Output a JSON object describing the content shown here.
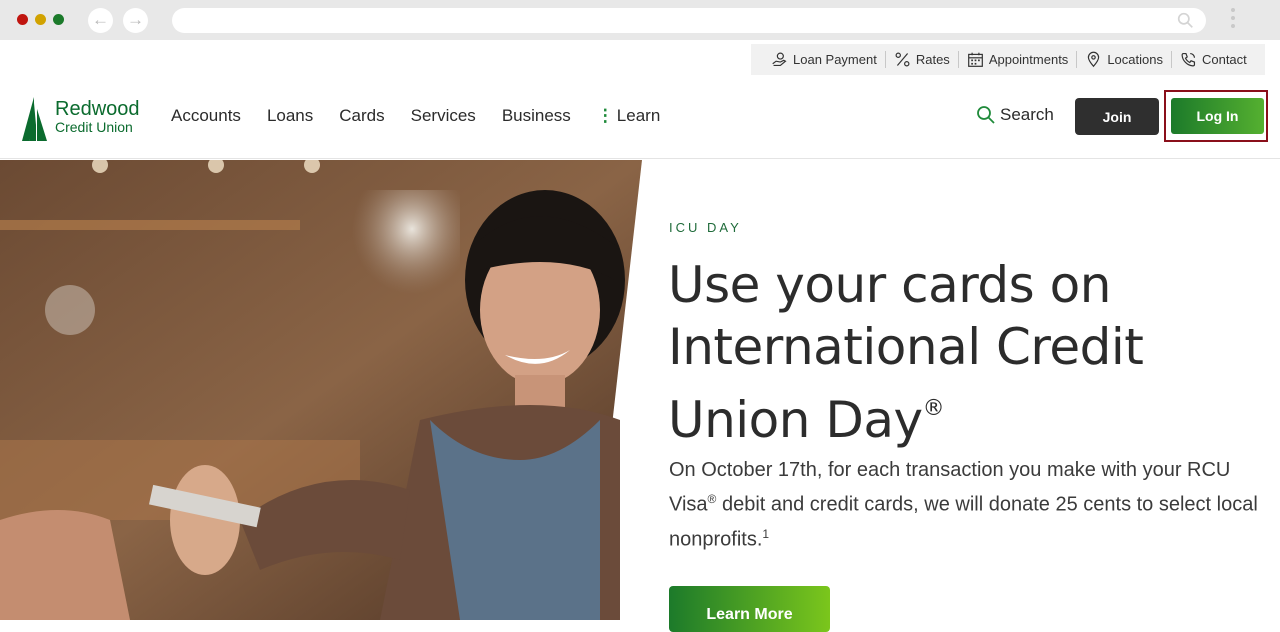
{
  "browser": {
    "back_icon": "arrow-left-icon",
    "forward_icon": "arrow-right-icon",
    "url": ""
  },
  "utility": {
    "loan_payment": "Loan Payment",
    "rates": "Rates",
    "appointments": "Appointments",
    "locations": "Locations",
    "contact": "Contact"
  },
  "brand": {
    "line1": "Redwood",
    "line2": "Credit Union",
    "color": "#0b6b2e"
  },
  "nav": {
    "accounts": "Accounts",
    "loans": "Loans",
    "cards": "Cards",
    "services": "Services",
    "business": "Business",
    "learn": "Learn",
    "learn_dots": "⋮"
  },
  "header": {
    "search": "Search",
    "join": "Join",
    "login": "Log In"
  },
  "hero": {
    "eyebrow": "ICU DAY",
    "headline_1": "Use your cards on",
    "headline_2": "International Credit",
    "headline_3": "Union Day",
    "headline_mark": "®",
    "body_1": "On October 17th, for each transaction you make with your RCU Visa",
    "body_mark": "®",
    "body_2": " debit and credit cards, we will donate 25 cents to select local nonprofits.",
    "body_footnote": "1",
    "cta": "Learn More"
  },
  "colors": {
    "accent": "#1c7a2a",
    "accent_light": "#7bc61c",
    "highlight": "#8a0f1a",
    "dark": "#2f2f2f"
  }
}
